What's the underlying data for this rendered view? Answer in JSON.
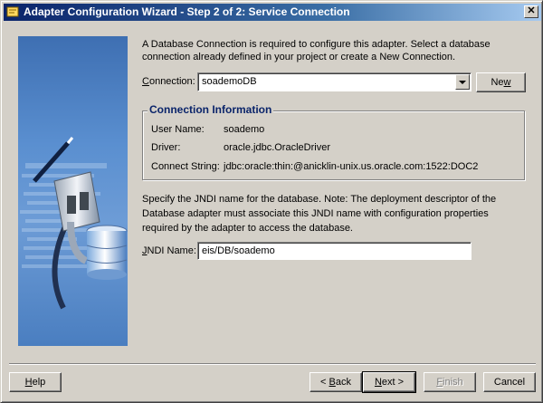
{
  "window": {
    "title": "Adapter Configuration Wizard - Step 2 of 2: Service Connection",
    "close_glyph": "✕"
  },
  "intro_text": "A Database Connection is required to configure this adapter. Select a database connection already defined in your project or create a New Connection.",
  "connection": {
    "label": "Connection:",
    "selected": "soademoDB",
    "new_button": "New"
  },
  "connection_info": {
    "title": "Connection Information",
    "rows": [
      {
        "label": "User Name:",
        "value": "soademo"
      },
      {
        "label": "Driver:",
        "value": "oracle.jdbc.OracleDriver"
      },
      {
        "label": "Connect String:",
        "value": "jdbc:oracle:thin:@anicklin-unix.us.oracle.com:1522:DOC2"
      }
    ]
  },
  "jndi": {
    "description": "Specify the JNDI name for the database.  Note: The deployment descriptor of the Database adapter must associate this JNDI name with configuration properties required by the adapter to access the database.",
    "label": "JNDI Name:",
    "value": "eis/DB/soademo"
  },
  "buttons": {
    "help": "Help",
    "back": "< Back",
    "next": "Next >",
    "finish": "Finish",
    "cancel": "Cancel"
  },
  "icons": {
    "title": "wizard-icon",
    "side": "database-plug-illustration"
  }
}
